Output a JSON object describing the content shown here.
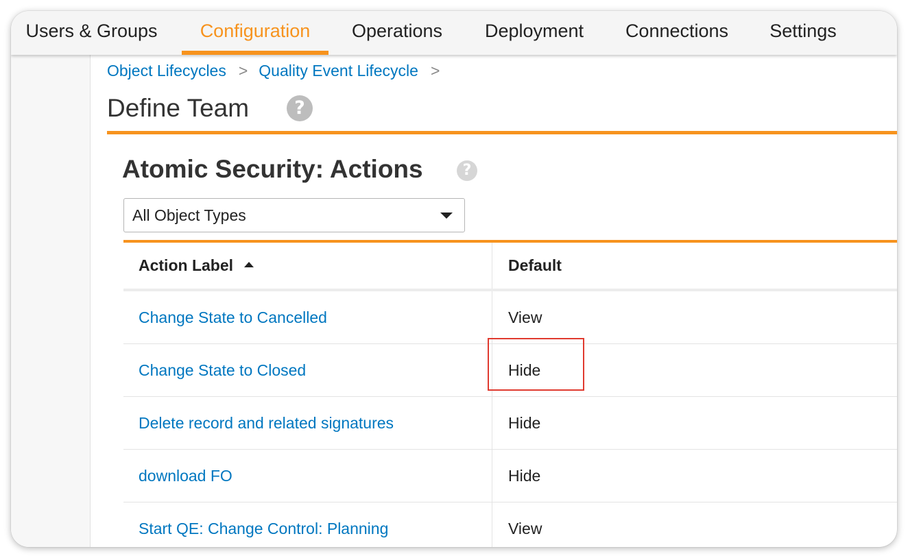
{
  "colors": {
    "accent": "#f7931e",
    "link": "#0077c0",
    "highlight": "#e03a2f"
  },
  "nav": {
    "tabs": [
      {
        "label": "Users & Groups",
        "active": false
      },
      {
        "label": "Configuration",
        "active": true
      },
      {
        "label": "Operations",
        "active": false
      },
      {
        "label": "Deployment",
        "active": false
      },
      {
        "label": "Connections",
        "active": false
      },
      {
        "label": "Settings",
        "active": false
      }
    ]
  },
  "breadcrumb": {
    "items": [
      "Object Lifecycles",
      "Quality Event Lifecycle"
    ],
    "separator": ">"
  },
  "page": {
    "title": "Define Team",
    "help_icon": "question-circle-icon"
  },
  "section": {
    "title": "Atomic Security: Actions",
    "help_icon": "question-circle-icon"
  },
  "filter": {
    "selected": "All Object Types"
  },
  "table": {
    "columns": [
      "Action Label",
      "Default"
    ],
    "sort_icon": "caret-up-icon",
    "rows": [
      {
        "label": "Change State to Cancelled",
        "default": "View"
      },
      {
        "label": "Change State to Closed",
        "default": "Hide",
        "highlighted": true
      },
      {
        "label": "Delete record and related signatures",
        "default": "Hide"
      },
      {
        "label": "download FO",
        "default": "Hide"
      },
      {
        "label": "Start QE: Change Control: Planning",
        "default": "View"
      }
    ]
  }
}
